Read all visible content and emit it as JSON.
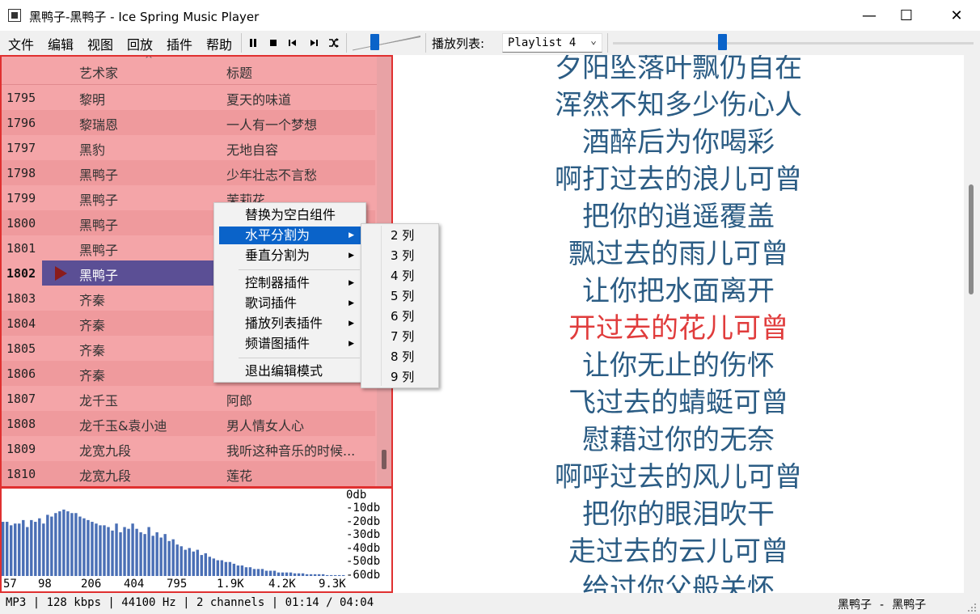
{
  "window": {
    "title": "黑鸭子-黑鸭子 - Ice Spring Music Player",
    "minimize": "—",
    "maximize": "☐",
    "close": "✕"
  },
  "menubar": [
    "文件",
    "编辑",
    "视图",
    "回放",
    "插件",
    "帮助"
  ],
  "controls": {
    "pause_icon": "pause-icon",
    "stop_icon": "stop-icon",
    "prev_icon": "previous-icon",
    "next_icon": "next-icon",
    "shuffle_icon": "shuffle-icon",
    "volume_level": 0.3,
    "progress_fraction": 0.29
  },
  "playlist_selector": {
    "label": "播放列表:",
    "selected": "Playlist 4"
  },
  "playlist": {
    "columns": [
      "艺术家",
      "标题"
    ],
    "sort_indicator": "^",
    "rows": [
      {
        "num": "1795",
        "artist": "黎明",
        "title": "夏天的味道"
      },
      {
        "num": "1796",
        "artist": "黎瑞恩",
        "title": "一人有一个梦想"
      },
      {
        "num": "1797",
        "artist": "黑豹",
        "title": "无地自容"
      },
      {
        "num": "1798",
        "artist": "黑鸭子",
        "title": "少年壮志不言愁"
      },
      {
        "num": "1799",
        "artist": "黑鸭子",
        "title": "茉莉花"
      },
      {
        "num": "1800",
        "artist": "黑鸭子",
        "title": ""
      },
      {
        "num": "1801",
        "artist": "黑鸭子",
        "title": ""
      },
      {
        "num": "1802",
        "artist": "黑鸭子",
        "title": ""
      },
      {
        "num": "1803",
        "artist": "齐秦",
        "title": ""
      },
      {
        "num": "1804",
        "artist": "齐秦",
        "title": ""
      },
      {
        "num": "1805",
        "artist": "齐秦",
        "title": ""
      },
      {
        "num": "1806",
        "artist": "齐秦",
        "title": ""
      },
      {
        "num": "1807",
        "artist": "龙千玉",
        "title": "阿郎"
      },
      {
        "num": "1808",
        "artist": "龙千玉&袁小迪",
        "title": "男人情女人心"
      },
      {
        "num": "1809",
        "artist": "龙宽九段",
        "title": "我听这种音乐的时候..."
      },
      {
        "num": "1810",
        "artist": "龙宽九段",
        "title": "莲花"
      }
    ],
    "current_index": 7
  },
  "context_menu": {
    "items": [
      {
        "label": "替换为空白组件",
        "submenu": false
      },
      {
        "label": "水平分割为",
        "submenu": true,
        "active": true
      },
      {
        "label": "垂直分割为",
        "submenu": true
      },
      {
        "label": "控制器插件",
        "submenu": true
      },
      {
        "label": "歌词插件",
        "submenu": true
      },
      {
        "label": "播放列表插件",
        "submenu": true
      },
      {
        "label": "频谱图插件",
        "submenu": true
      },
      {
        "label": "退出编辑模式",
        "submenu": false
      }
    ],
    "arrow": "▶"
  },
  "submenu": {
    "items": [
      "2 列",
      "3 列",
      "4 列",
      "5 列",
      "6 列",
      "7 列",
      "8 列",
      "9 列"
    ]
  },
  "spectrum": {
    "db_labels": [
      "0db",
      "-10db",
      "-20db",
      "-30db",
      "-40db",
      "-50db",
      "-60db"
    ],
    "freq_labels": [
      "57",
      "98",
      "206",
      "404",
      "795",
      "1.9K",
      "4.2K",
      "9.3K"
    ],
    "bar_color": "#4a6fb5",
    "levels": [
      0.62,
      0.62,
      0.58,
      0.6,
      0.6,
      0.64,
      0.56,
      0.64,
      0.62,
      0.66,
      0.6,
      0.7,
      0.68,
      0.72,
      0.74,
      0.76,
      0.74,
      0.72,
      0.72,
      0.68,
      0.66,
      0.64,
      0.62,
      0.6,
      0.58,
      0.58,
      0.56,
      0.52,
      0.6,
      0.5,
      0.56,
      0.54,
      0.6,
      0.54,
      0.5,
      0.48,
      0.56,
      0.46,
      0.5,
      0.44,
      0.48,
      0.4,
      0.42,
      0.36,
      0.34,
      0.3,
      0.32,
      0.28,
      0.3,
      0.24,
      0.26,
      0.22,
      0.2,
      0.18,
      0.18,
      0.16,
      0.16,
      0.14,
      0.12,
      0.12,
      0.1,
      0.1,
      0.08,
      0.08,
      0.08,
      0.06,
      0.06,
      0.06,
      0.04,
      0.04,
      0.04,
      0.04,
      0.03,
      0.03,
      0.03,
      0.02,
      0.02,
      0.02,
      0.02,
      0.02,
      0.01,
      0.01,
      0.01,
      0.01,
      0.01
    ]
  },
  "lyrics": {
    "lines": [
      "夕阳坠落叶飘仍自在",
      "浑然不知多少伤心人",
      "酒醉后为你喝彩",
      "啊打过去的浪儿可曾",
      "把你的逍遥覆盖",
      "飘过去的雨儿可曾",
      "让你把水面离开",
      "开过去的花儿可曾",
      "让你无止的伤怀",
      "飞过去的蜻蜓可曾",
      "慰藉过你的无奈",
      "啊呼过去的风儿可曾",
      "把你的眼泪吹干",
      "走过去的云儿可曾",
      "给过你父般关怀"
    ],
    "highlight_index": 7,
    "normal_color": "#2b5c84",
    "highlight_color": "#e03c3c"
  },
  "status": {
    "info": "MP3 | 128 kbps | 44100 Hz | 2 channels | 01:14 / 04:04",
    "track": "黑鸭子 - 黑鸭子"
  }
}
